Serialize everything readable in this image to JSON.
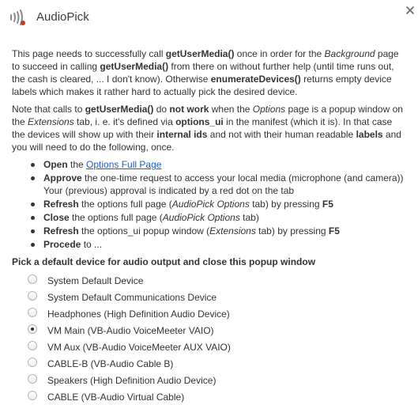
{
  "app": {
    "title": "AudioPick"
  },
  "intro": {
    "p1": [
      {
        "t": "This page needs to successfully call "
      },
      {
        "t": "getUserMedia()",
        "b": true
      },
      {
        "t": " once in order for the "
      },
      {
        "t": "Background",
        "i": true
      },
      {
        "t": " page to succeed in calling "
      },
      {
        "t": "getUserMedia()",
        "b": true
      },
      {
        "t": " from there on without further help (until time runs out, the cash is cleared, ... I don't know). Otherwise "
      },
      {
        "t": "enumerateDevices()",
        "b": true
      },
      {
        "t": " returns empty device labels which makes it rather hard to actually pick the desired device."
      }
    ],
    "p2": [
      {
        "t": "Note that calls to "
      },
      {
        "t": "getUserMedia()",
        "b": true
      },
      {
        "t": " do "
      },
      {
        "t": "not work",
        "b": true
      },
      {
        "t": " when the "
      },
      {
        "t": "Options",
        "i": true
      },
      {
        "t": " page is a popup window on the "
      },
      {
        "t": "Extensions",
        "i": true
      },
      {
        "t": " tab, i. e. it's defined via "
      },
      {
        "t": "options_ui",
        "b": true
      },
      {
        "t": " in the manifest (which it is). In that case the devices will show up with their "
      },
      {
        "t": "internal ids",
        "b": true
      },
      {
        "t": " and not with their human readable "
      },
      {
        "t": "labels",
        "b": true
      },
      {
        "t": " and you will need to do the following, once."
      }
    ]
  },
  "steps": [
    [
      {
        "t": "Open",
        "b": true
      },
      {
        "t": " the "
      },
      {
        "t": "Options Full Page",
        "link": true
      }
    ],
    [
      {
        "t": "Approve",
        "b": true
      },
      {
        "t": " the one-time request to access your local media (microphone (and camera)) Your (previous) approval is indicated by a red dot on the tab"
      }
    ],
    [
      {
        "t": "Refresh",
        "b": true
      },
      {
        "t": " the options full page ("
      },
      {
        "t": "AudioPick Options",
        "i": true
      },
      {
        "t": " tab) by pressing "
      },
      {
        "t": "F5",
        "b": true
      }
    ],
    [
      {
        "t": "Close",
        "b": true
      },
      {
        "t": " the options full page ("
      },
      {
        "t": "AudioPick Options",
        "i": true
      },
      {
        "t": " tab)"
      }
    ],
    [
      {
        "t": "Refresh",
        "b": true
      },
      {
        "t": " the options_ui popup window ("
      },
      {
        "t": "Extensions",
        "i": true
      },
      {
        "t": " tab) by pressing "
      },
      {
        "t": "F5",
        "b": true
      }
    ],
    [
      {
        "t": "Procede",
        "b": true
      },
      {
        "t": " to ..."
      }
    ]
  ],
  "picker": {
    "heading": "Pick a default device for audio output and close this popup window",
    "selected_index": 3,
    "devices": [
      "System Default Device",
      "System Default Communications Device",
      "Headphones (High Definition Audio Device)",
      "VM Main (VB-Audio VoiceMeeter VAIO)",
      "VM Aux (VB-Audio VoiceMeeter AUX VAIO)",
      "CABLE-B (VB-Audio Cable B)",
      "Speakers (High Definition Audio Device)",
      "CABLE (VB-Audio Virtual Cable)"
    ]
  },
  "icons": {
    "app": "sound-waves-icon",
    "close": "close-icon"
  }
}
